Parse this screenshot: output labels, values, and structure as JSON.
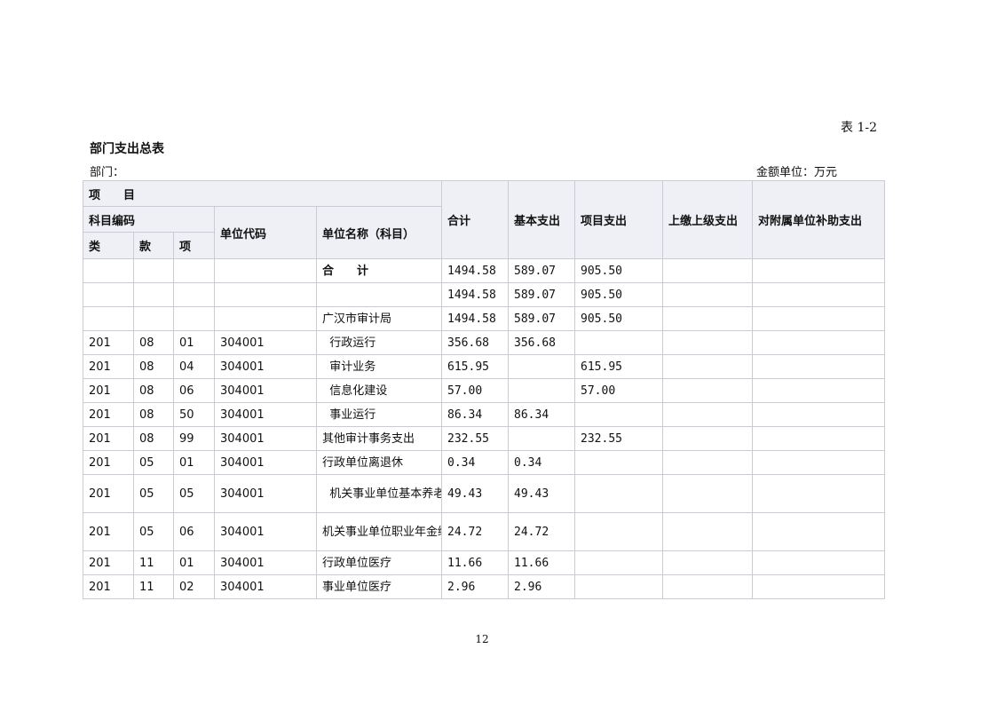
{
  "table_no": "表 1-2",
  "title": "部门支出总表",
  "dept_label": "部门：",
  "unit_label": "金额单位：万元",
  "header": {
    "item": "项　　目",
    "subject_code": "科目编码",
    "lei": "类",
    "kuan": "款",
    "xiang": "项",
    "unit_code": "单位代码",
    "unit_name": "单位名称（科目）",
    "total": "合计",
    "basic": "基本支出",
    "project": "项目支出",
    "upper": "上缴上级支出",
    "subsidy": "对附属单位补助支出"
  },
  "rows": [
    {
      "lei": "",
      "kuan": "",
      "xiang": "",
      "code": "",
      "name": "合　　计",
      "total": "1494.58",
      "basic": "589.07",
      "project": "905.50",
      "upper": "",
      "subsidy": ""
    },
    {
      "lei": "",
      "kuan": "",
      "xiang": "",
      "code": "",
      "name": "",
      "total": "1494.58",
      "basic": "589.07",
      "project": "905.50",
      "upper": "",
      "subsidy": ""
    },
    {
      "lei": "",
      "kuan": "",
      "xiang": "",
      "code": "",
      "name": "广汉市审计局",
      "total": "1494.58",
      "basic": "589.07",
      "project": "905.50",
      "upper": "",
      "subsidy": ""
    },
    {
      "lei": "201",
      "kuan": "08",
      "xiang": "01",
      "code": "304001",
      "name": "  行政运行",
      "total": "356.68",
      "basic": "356.68",
      "project": "",
      "upper": "",
      "subsidy": ""
    },
    {
      "lei": "201",
      "kuan": "08",
      "xiang": "04",
      "code": "304001",
      "name": "  审计业务",
      "total": "615.95",
      "basic": "",
      "project": "615.95",
      "upper": "",
      "subsidy": ""
    },
    {
      "lei": "201",
      "kuan": "08",
      "xiang": "06",
      "code": "304001",
      "name": "  信息化建设",
      "total": "57.00",
      "basic": "",
      "project": "57.00",
      "upper": "",
      "subsidy": ""
    },
    {
      "lei": "201",
      "kuan": "08",
      "xiang": "50",
      "code": "304001",
      "name": "  事业运行",
      "total": "86.34",
      "basic": "86.34",
      "project": "",
      "upper": "",
      "subsidy": ""
    },
    {
      "lei": "201",
      "kuan": "08",
      "xiang": "99",
      "code": "304001",
      "name": "其他审计事务支出",
      "total": "232.55",
      "basic": "",
      "project": "232.55",
      "upper": "",
      "subsidy": ""
    },
    {
      "lei": "201",
      "kuan": "05",
      "xiang": "01",
      "code": "304001",
      "name": "行政单位离退休",
      "total": "0.34",
      "basic": "0.34",
      "project": "",
      "upper": "",
      "subsidy": ""
    },
    {
      "lei": "201",
      "kuan": "05",
      "xiang": "05",
      "code": "304001",
      "name": "  机关事业单位基本养老保险缴费支出",
      "total": "49.43",
      "basic": "49.43",
      "project": "",
      "upper": "",
      "subsidy": ""
    },
    {
      "lei": "201",
      "kuan": "05",
      "xiang": "06",
      "code": "304001",
      "name": "机关事业单位职业年金缴费支出",
      "total": "24.72",
      "basic": "24.72",
      "project": "",
      "upper": "",
      "subsidy": ""
    },
    {
      "lei": "201",
      "kuan": "11",
      "xiang": "01",
      "code": "304001",
      "name": "行政单位医疗",
      "total": "11.66",
      "basic": "11.66",
      "project": "",
      "upper": "",
      "subsidy": ""
    },
    {
      "lei": "201",
      "kuan": "11",
      "xiang": "02",
      "code": "304001",
      "name": "事业单位医疗",
      "total": "2.96",
      "basic": "2.96",
      "project": "",
      "upper": "",
      "subsidy": ""
    }
  ],
  "page_number": "12"
}
